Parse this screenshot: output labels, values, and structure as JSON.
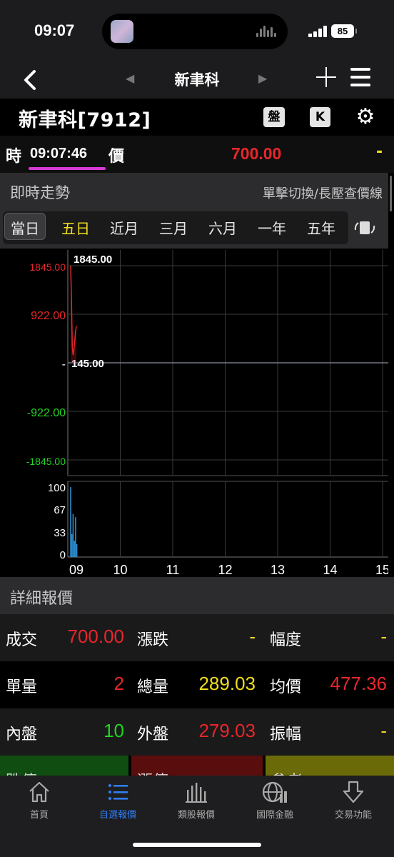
{
  "status": {
    "time": "09:07",
    "battery": "85"
  },
  "nav": {
    "title": "新聿科"
  },
  "stock": {
    "name": "新聿科[7912]",
    "pan_label": "盤",
    "k_label": "K"
  },
  "quote": {
    "shi_label": "時",
    "time": "09:07:46",
    "jia_label": "價",
    "price": "700.00",
    "change": "-"
  },
  "section": {
    "title": "即時走勢",
    "hint": "單擊切換/長壓查價線"
  },
  "tabs": [
    "當日",
    "五日",
    "近月",
    "三月",
    "六月",
    "一年",
    "五年"
  ],
  "chart_data": {
    "type": "line",
    "price_axis": {
      "ticks": [
        "1845.00",
        "922.00",
        "-",
        "-922.00",
        "-1845.00"
      ],
      "high_label": "1845.00",
      "ref_label": "145.00",
      "ylim": [
        -1845,
        1845
      ]
    },
    "volume_axis": {
      "ticks": [
        "100",
        "67",
        "33",
        "0"
      ],
      "ylim": [
        0,
        100
      ]
    },
    "x_ticks": [
      "09",
      "10",
      "11",
      "12",
      "13",
      "14",
      "15"
    ],
    "price_series": [
      {
        "t": 0.0,
        "v": 1845
      },
      {
        "t": 0.02,
        "v": 1200
      },
      {
        "t": 0.04,
        "v": 300
      },
      {
        "t": 0.06,
        "v": 150
      },
      {
        "t": 0.08,
        "v": 260
      },
      {
        "t": 0.1,
        "v": 420
      },
      {
        "t": 0.12,
        "v": 600
      },
      {
        "t": 0.14,
        "v": 700
      }
    ],
    "volume_series": [
      {
        "t": 0.0,
        "v": 100
      },
      {
        "t": 0.03,
        "v": 30
      },
      {
        "t": 0.06,
        "v": 60
      },
      {
        "t": 0.09,
        "v": 20
      },
      {
        "t": 0.12,
        "v": 55
      },
      {
        "t": 0.15,
        "v": 15
      }
    ],
    "colors": {
      "up": "#e8262a",
      "down": "#22d422",
      "volume": "#2a8fd0",
      "grid": "#3a3a3a"
    }
  },
  "detail": {
    "title": "詳細報價",
    "rows": [
      [
        {
          "k": "成交",
          "v": "700.00",
          "c": "red"
        },
        {
          "k": "漲跌",
          "v": "-",
          "c": "yel"
        },
        {
          "k": "幅度",
          "v": "-",
          "c": "yel"
        }
      ],
      [
        {
          "k": "單量",
          "v": "2",
          "c": "red"
        },
        {
          "k": "總量",
          "v": "289.03",
          "c": "yel"
        },
        {
          "k": "均價",
          "v": "477.36",
          "c": "red"
        }
      ],
      [
        {
          "k": "內盤",
          "v": "10",
          "c": "grn"
        },
        {
          "k": "外盤",
          "v": "279.03",
          "c": "red"
        },
        {
          "k": "振幅",
          "v": "-",
          "c": "yel"
        }
      ]
    ],
    "cards": [
      "跌停",
      "漲停",
      "參考"
    ]
  },
  "tabbar": [
    {
      "label": "首頁",
      "icon": "home-icon"
    },
    {
      "label": "自選報價",
      "icon": "list-icon",
      "active": true
    },
    {
      "label": "類股報價",
      "icon": "bar-chart-icon"
    },
    {
      "label": "國際金融",
      "icon": "globe-icon"
    },
    {
      "label": "交易功能",
      "icon": "trade-arrow-icon"
    }
  ]
}
